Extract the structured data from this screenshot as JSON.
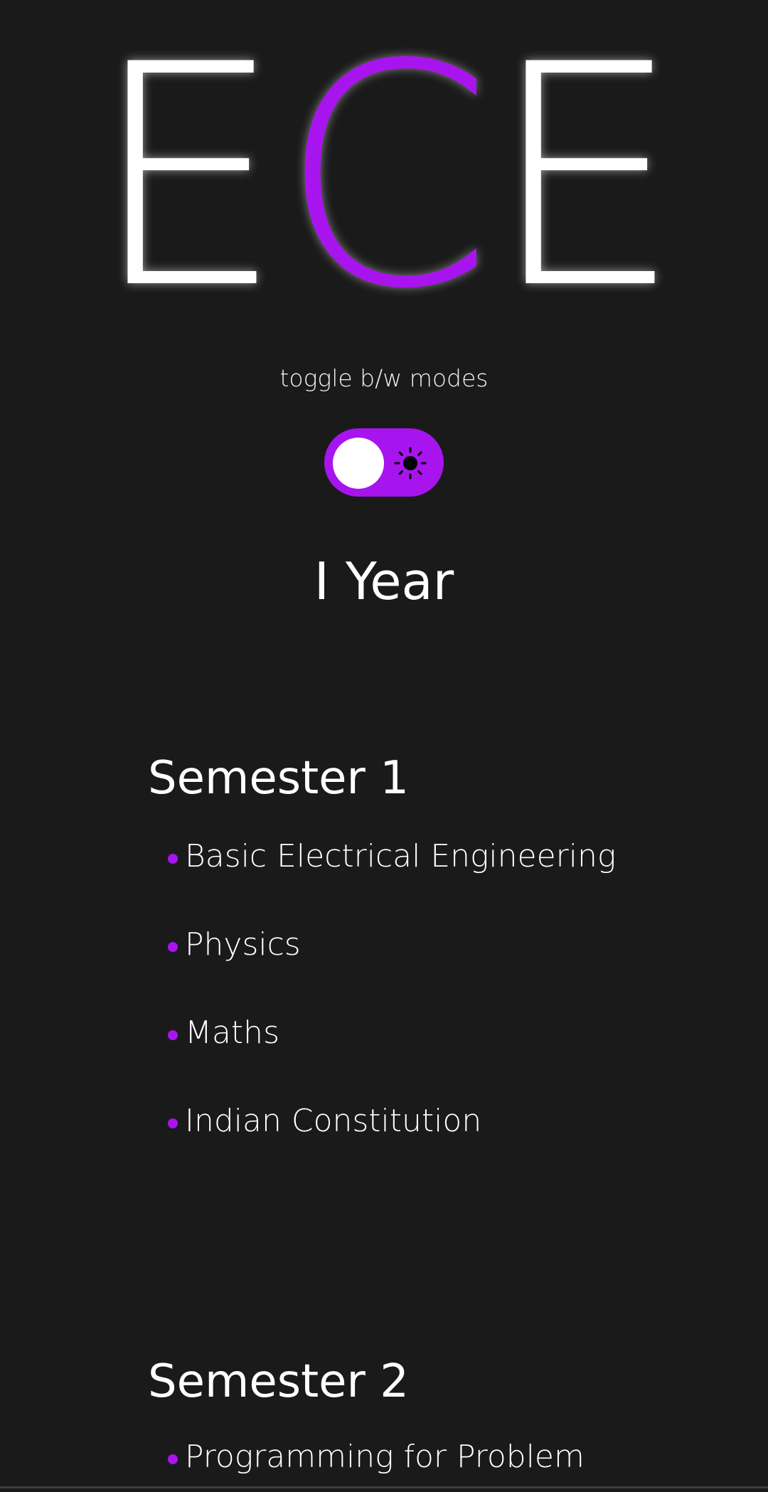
{
  "hero": {
    "letters": [
      "E",
      "C",
      "E"
    ]
  },
  "theme": {
    "background": "#1a1a1a",
    "accent": "#a814ee",
    "text": "#ffffff"
  },
  "toggle": {
    "caption": "toggle b/w modes",
    "state": "dark",
    "icon": "sun-icon"
  },
  "year": {
    "title": "I Year"
  },
  "semesters": [
    {
      "title": "Semester 1",
      "subjects": [
        "Basic Electrical Engineering",
        "Physics",
        "Maths",
        "Indian Constitution"
      ]
    },
    {
      "title": "Semester 2",
      "subjects": [
        "Programming for Problem"
      ]
    }
  ]
}
